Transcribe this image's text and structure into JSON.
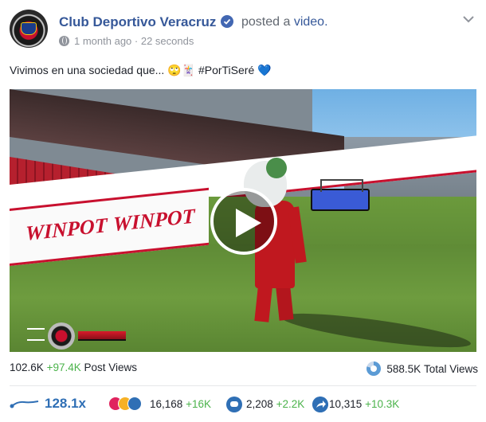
{
  "post": {
    "page_name": "Club Deportivo Veracruz",
    "action_prefix": "posted a ",
    "action_link": "video.",
    "time_ago": "1 month ago",
    "separator": " · ",
    "duration": "22 seconds",
    "caption": "Vivimos en una sociedad que... 🙄🃏 #PorTiSeré 💙",
    "video_billboard_text": "WINPOT"
  },
  "stats": {
    "post_views": "102.6K",
    "post_views_gain": "+97.4K",
    "post_views_label": "Post Views",
    "total_views": "588.5K",
    "total_views_label": "Total Views"
  },
  "metrics": {
    "multiplier": "128.1x",
    "reactions": "16,168",
    "reactions_gain": "+16K",
    "comments": "2,208",
    "comments_gain": "+2.2K",
    "shares": "10,315",
    "shares_gain": "+10.3K"
  },
  "icons": {
    "verified": "verified-badge-icon",
    "options": "chevron-down-icon",
    "privacy": "globe-icon",
    "play": "play-icon",
    "total_views": "donut-chart-icon",
    "trend": "trend-line-icon",
    "reactions": [
      "love-reaction-icon",
      "haha-reaction-icon",
      "like-reaction-icon"
    ],
    "comments": "comment-icon",
    "shares": "share-icon"
  },
  "colors": {
    "link": "#365899",
    "gain": "#4bb34b",
    "accent": "#2f6fb5",
    "brand_red": "#c8102e"
  }
}
